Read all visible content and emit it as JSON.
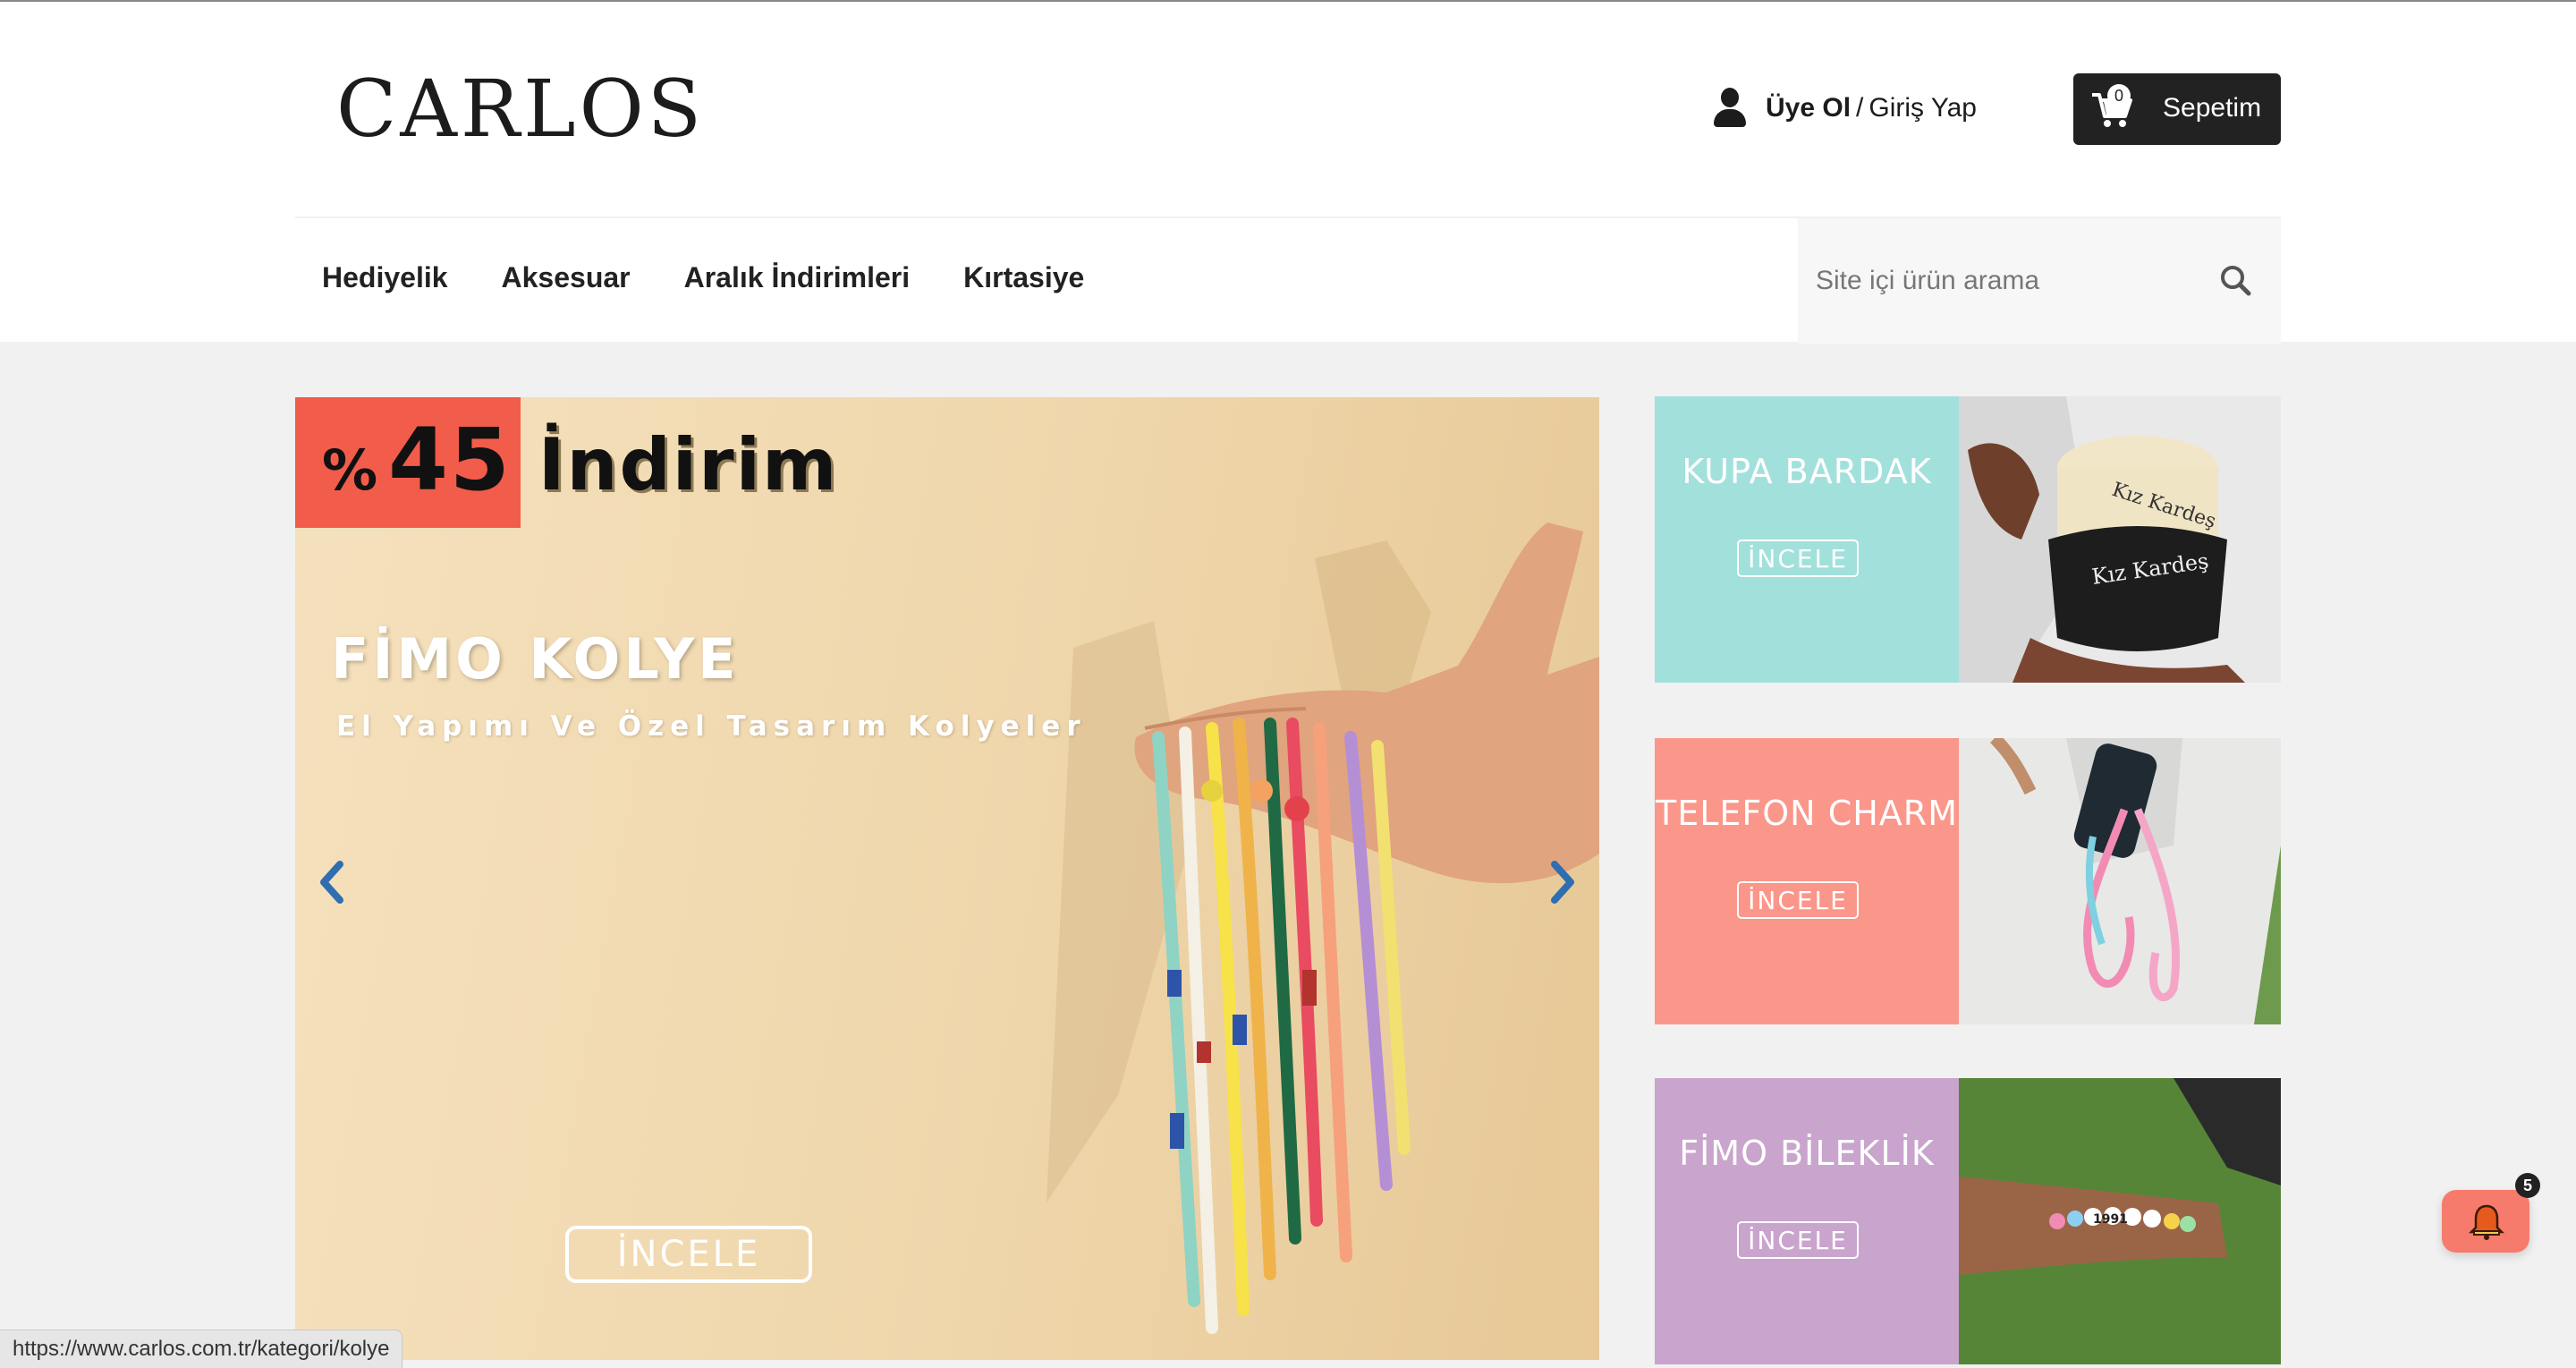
{
  "header": {
    "logo": "CARLOS",
    "account": {
      "signup_label": "Üye Ol",
      "separator": "/",
      "login_label": "Giriş Yap"
    },
    "cart": {
      "count": "0",
      "label": "Sepetim"
    }
  },
  "nav": {
    "items": [
      {
        "label": "Hediyelik"
      },
      {
        "label": "Aksesuar"
      },
      {
        "label": "Aralık İndirimleri"
      },
      {
        "label": "Kırtasiye"
      }
    ]
  },
  "search": {
    "placeholder": "Site içi ürün arama",
    "value": ""
  },
  "slider": {
    "discount_value": "45",
    "discount_symbol": "%",
    "discount_word": "İndirim",
    "title": "FİMO KOLYE",
    "subtitle": "El Yapımı Ve Özel Tasarım Kolyeler",
    "cta": "İNCELE"
  },
  "banners": [
    {
      "title": "KUPA BARDAK",
      "button": "İNCELE",
      "color": "#a2e0dc",
      "photo_text_1": "Kız Kardeş",
      "photo_text_2": "Kız Kardeş"
    },
    {
      "title": "TELEFON CHARM",
      "button": "İNCELE",
      "color": "#fb968a"
    },
    {
      "title": "FİMO BİLEKLİK",
      "button": "İNCELE",
      "color": "#c9a4cd",
      "photo_text_1": "1991"
    }
  ],
  "status_url": "https://www.carlos.com.tr/kategori/kolye",
  "notifications": {
    "count": "5"
  },
  "colors": {
    "accent_dark": "#222222",
    "discount_red": "#f25c4b",
    "bell": "#f67b6c"
  }
}
